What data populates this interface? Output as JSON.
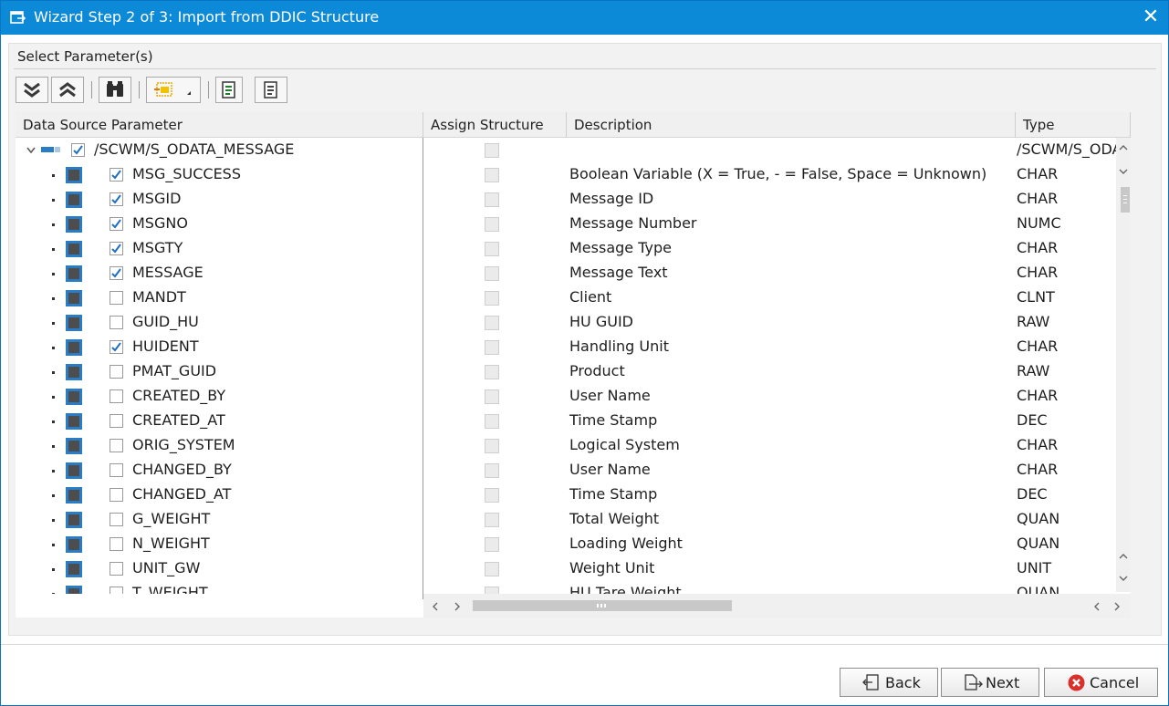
{
  "window": {
    "title": "Wizard Step 2 of 3: Import from DDIC Structure"
  },
  "section": {
    "title": "Select Parameter(s)"
  },
  "columns": {
    "param": "Data Source Parameter",
    "assign": "Assign Structure",
    "desc": "Description",
    "type": "Type"
  },
  "root": {
    "label": "/SCWM/S_ODATA_MESSAGE",
    "type": "/SCWM/S_ODA",
    "checked": true
  },
  "rows": [
    {
      "label": "MSG_SUCCESS",
      "desc": "Boolean Variable (X = True, - = False, Space = Unknown)",
      "type": "CHAR",
      "checked": true
    },
    {
      "label": "MSGID",
      "desc": "Message ID",
      "type": "CHAR",
      "checked": true
    },
    {
      "label": "MSGNO",
      "desc": "Message Number",
      "type": "NUMC",
      "checked": true
    },
    {
      "label": "MSGTY",
      "desc": "Message Type",
      "type": "CHAR",
      "checked": true
    },
    {
      "label": "MESSAGE",
      "desc": "Message Text",
      "type": "CHAR",
      "checked": true
    },
    {
      "label": "MANDT",
      "desc": "Client",
      "type": "CLNT",
      "checked": false
    },
    {
      "label": "GUID_HU",
      "desc": "HU GUID",
      "type": "RAW",
      "checked": false
    },
    {
      "label": "HUIDENT",
      "desc": "Handling Unit",
      "type": "CHAR",
      "checked": true
    },
    {
      "label": "PMAT_GUID",
      "desc": "Product",
      "type": "RAW",
      "checked": false
    },
    {
      "label": "CREATED_BY",
      "desc": "User Name",
      "type": "CHAR",
      "checked": false
    },
    {
      "label": "CREATED_AT",
      "desc": "Time Stamp",
      "type": "DEC",
      "checked": false
    },
    {
      "label": "ORIG_SYSTEM",
      "desc": "Logical System",
      "type": "CHAR",
      "checked": false
    },
    {
      "label": "CHANGED_BY",
      "desc": "User Name",
      "type": "CHAR",
      "checked": false
    },
    {
      "label": "CHANGED_AT",
      "desc": "Time Stamp",
      "type": "DEC",
      "checked": false
    },
    {
      "label": "G_WEIGHT",
      "desc": "Total Weight",
      "type": "QUAN",
      "checked": false
    },
    {
      "label": "N_WEIGHT",
      "desc": "Loading Weight",
      "type": "QUAN",
      "checked": false
    },
    {
      "label": "UNIT_GW",
      "desc": "Weight Unit",
      "type": "UNIT",
      "checked": false
    },
    {
      "label": "T_WEIGHT",
      "desc": "HU Tare Weight",
      "type": "QUAN",
      "checked": false
    }
  ],
  "buttons": {
    "back": "Back",
    "next": "Next",
    "cancel": "Cancel"
  },
  "colors": {
    "title_bar": "#0c8ad8",
    "tree_node": "#2a7dc4",
    "check": "#1f6fc4",
    "cancel_icon": "#d9302c"
  }
}
